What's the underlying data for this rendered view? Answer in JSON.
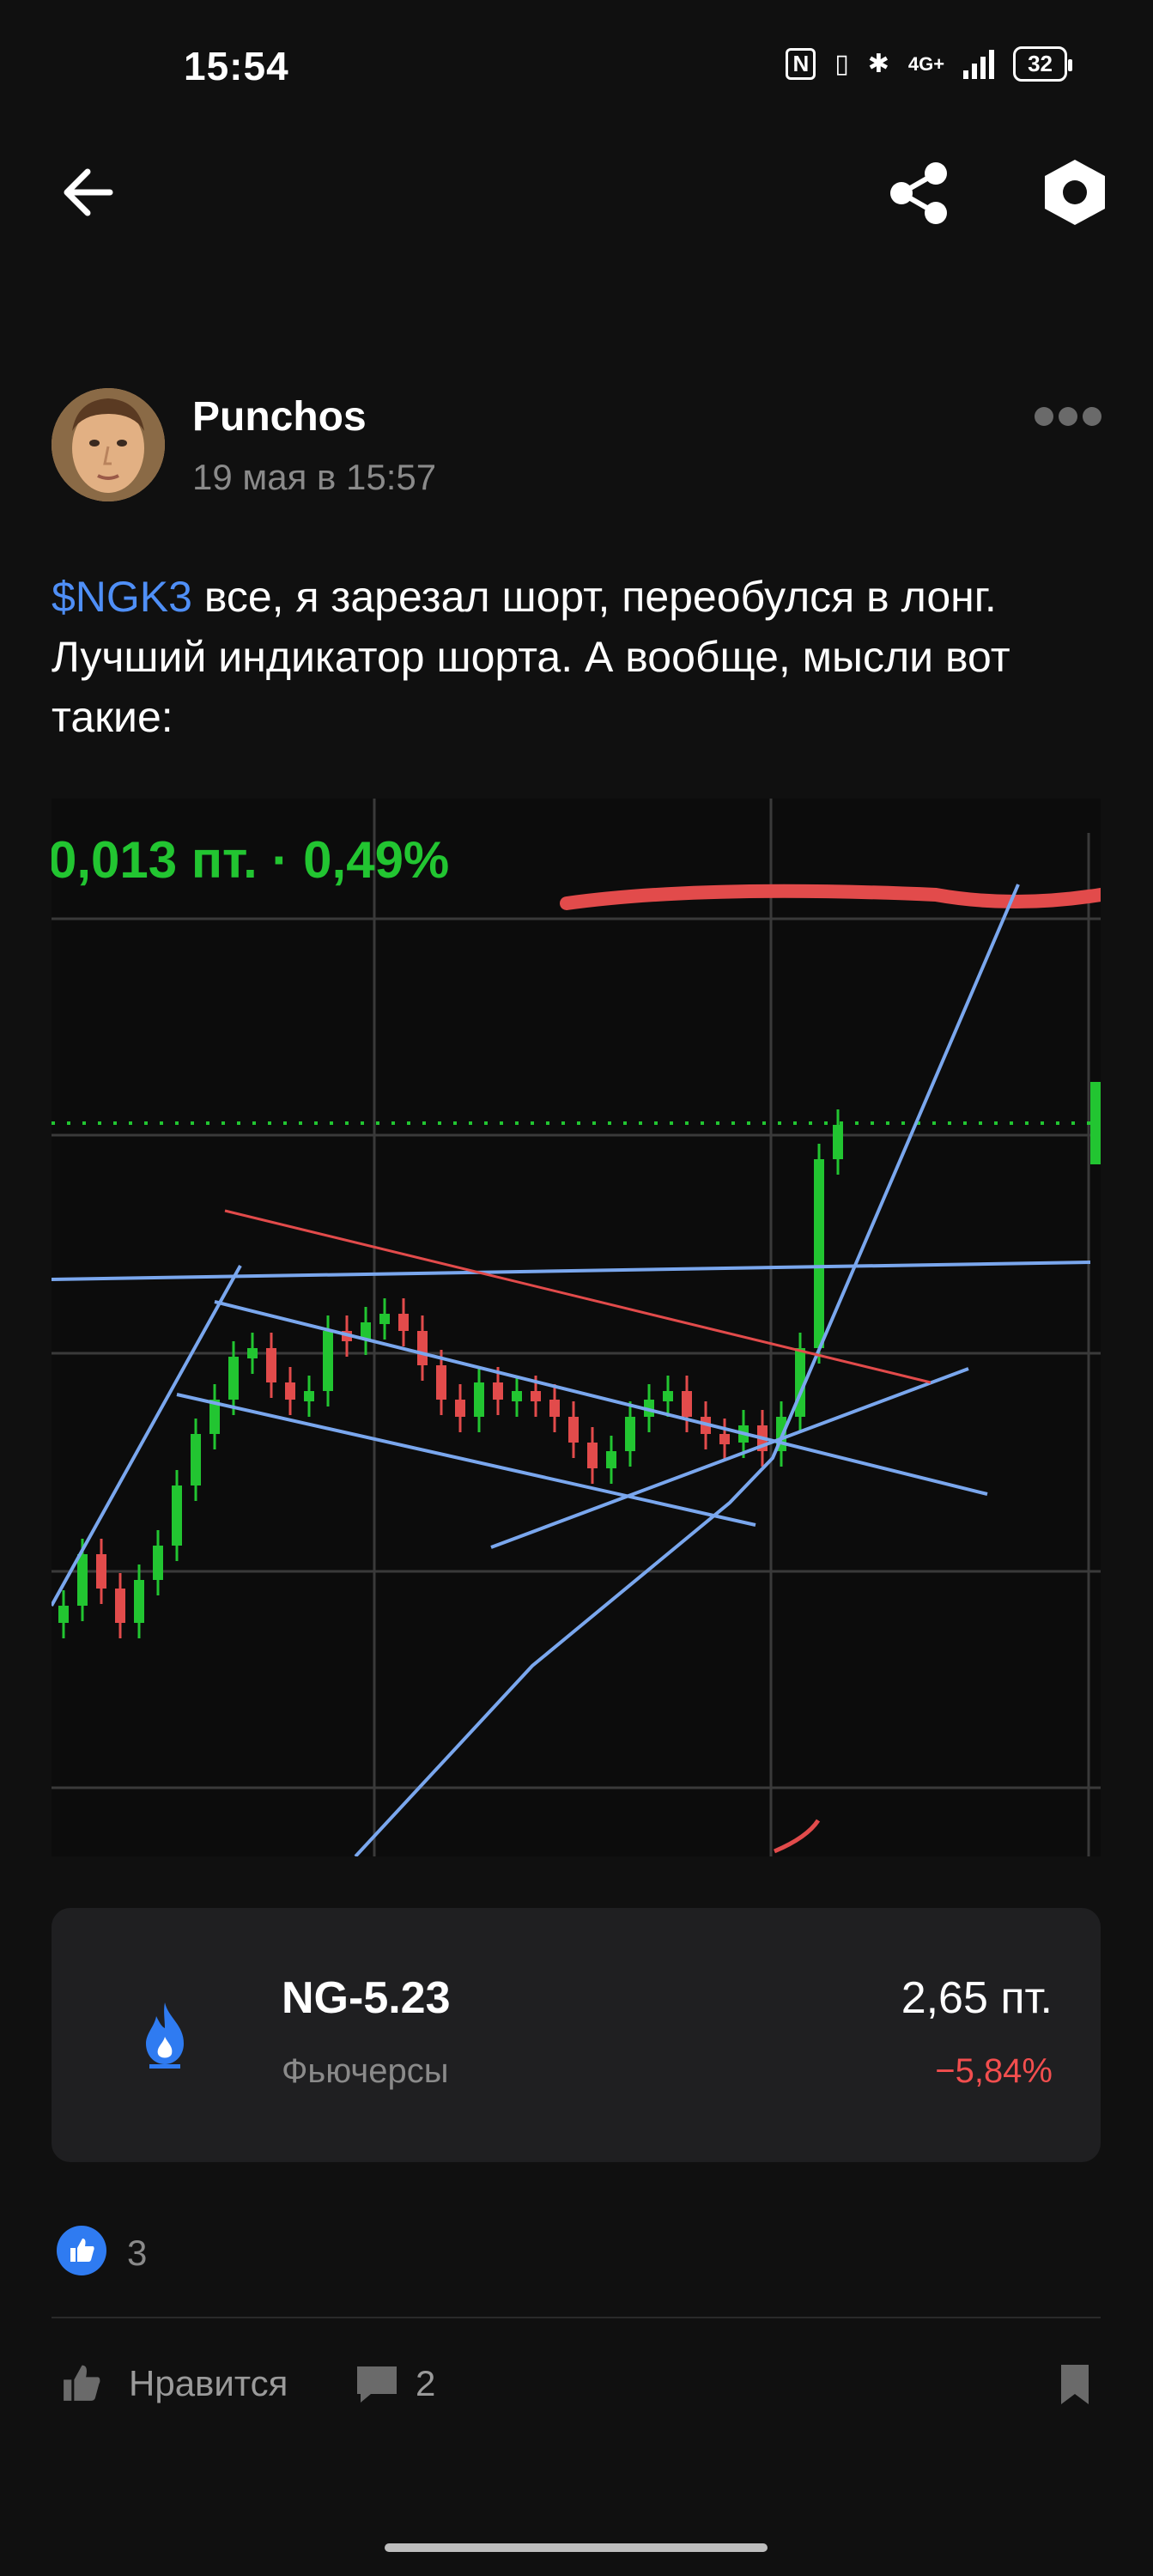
{
  "status_bar": {
    "time": "15:54",
    "network": "4G+",
    "battery": "32"
  },
  "post": {
    "author": "Punchos",
    "date": "19 мая в 15:57",
    "ticker": "$NGK3",
    "text": " все,  я зарезал шорт, переобулся в лонг. Лучший индикатор шорта. А вообще, мысли вот такие:"
  },
  "embedded_chart": {
    "header_value": "0,013 пт. · 0,49%"
  },
  "instrument": {
    "name": "NG-5.23",
    "type": "Фьючерсы",
    "price": "2,65  пт.",
    "change": "−5,84%"
  },
  "reactions": {
    "count": "3"
  },
  "actions": {
    "like_label": "Нравится",
    "comments_count": "2"
  }
}
